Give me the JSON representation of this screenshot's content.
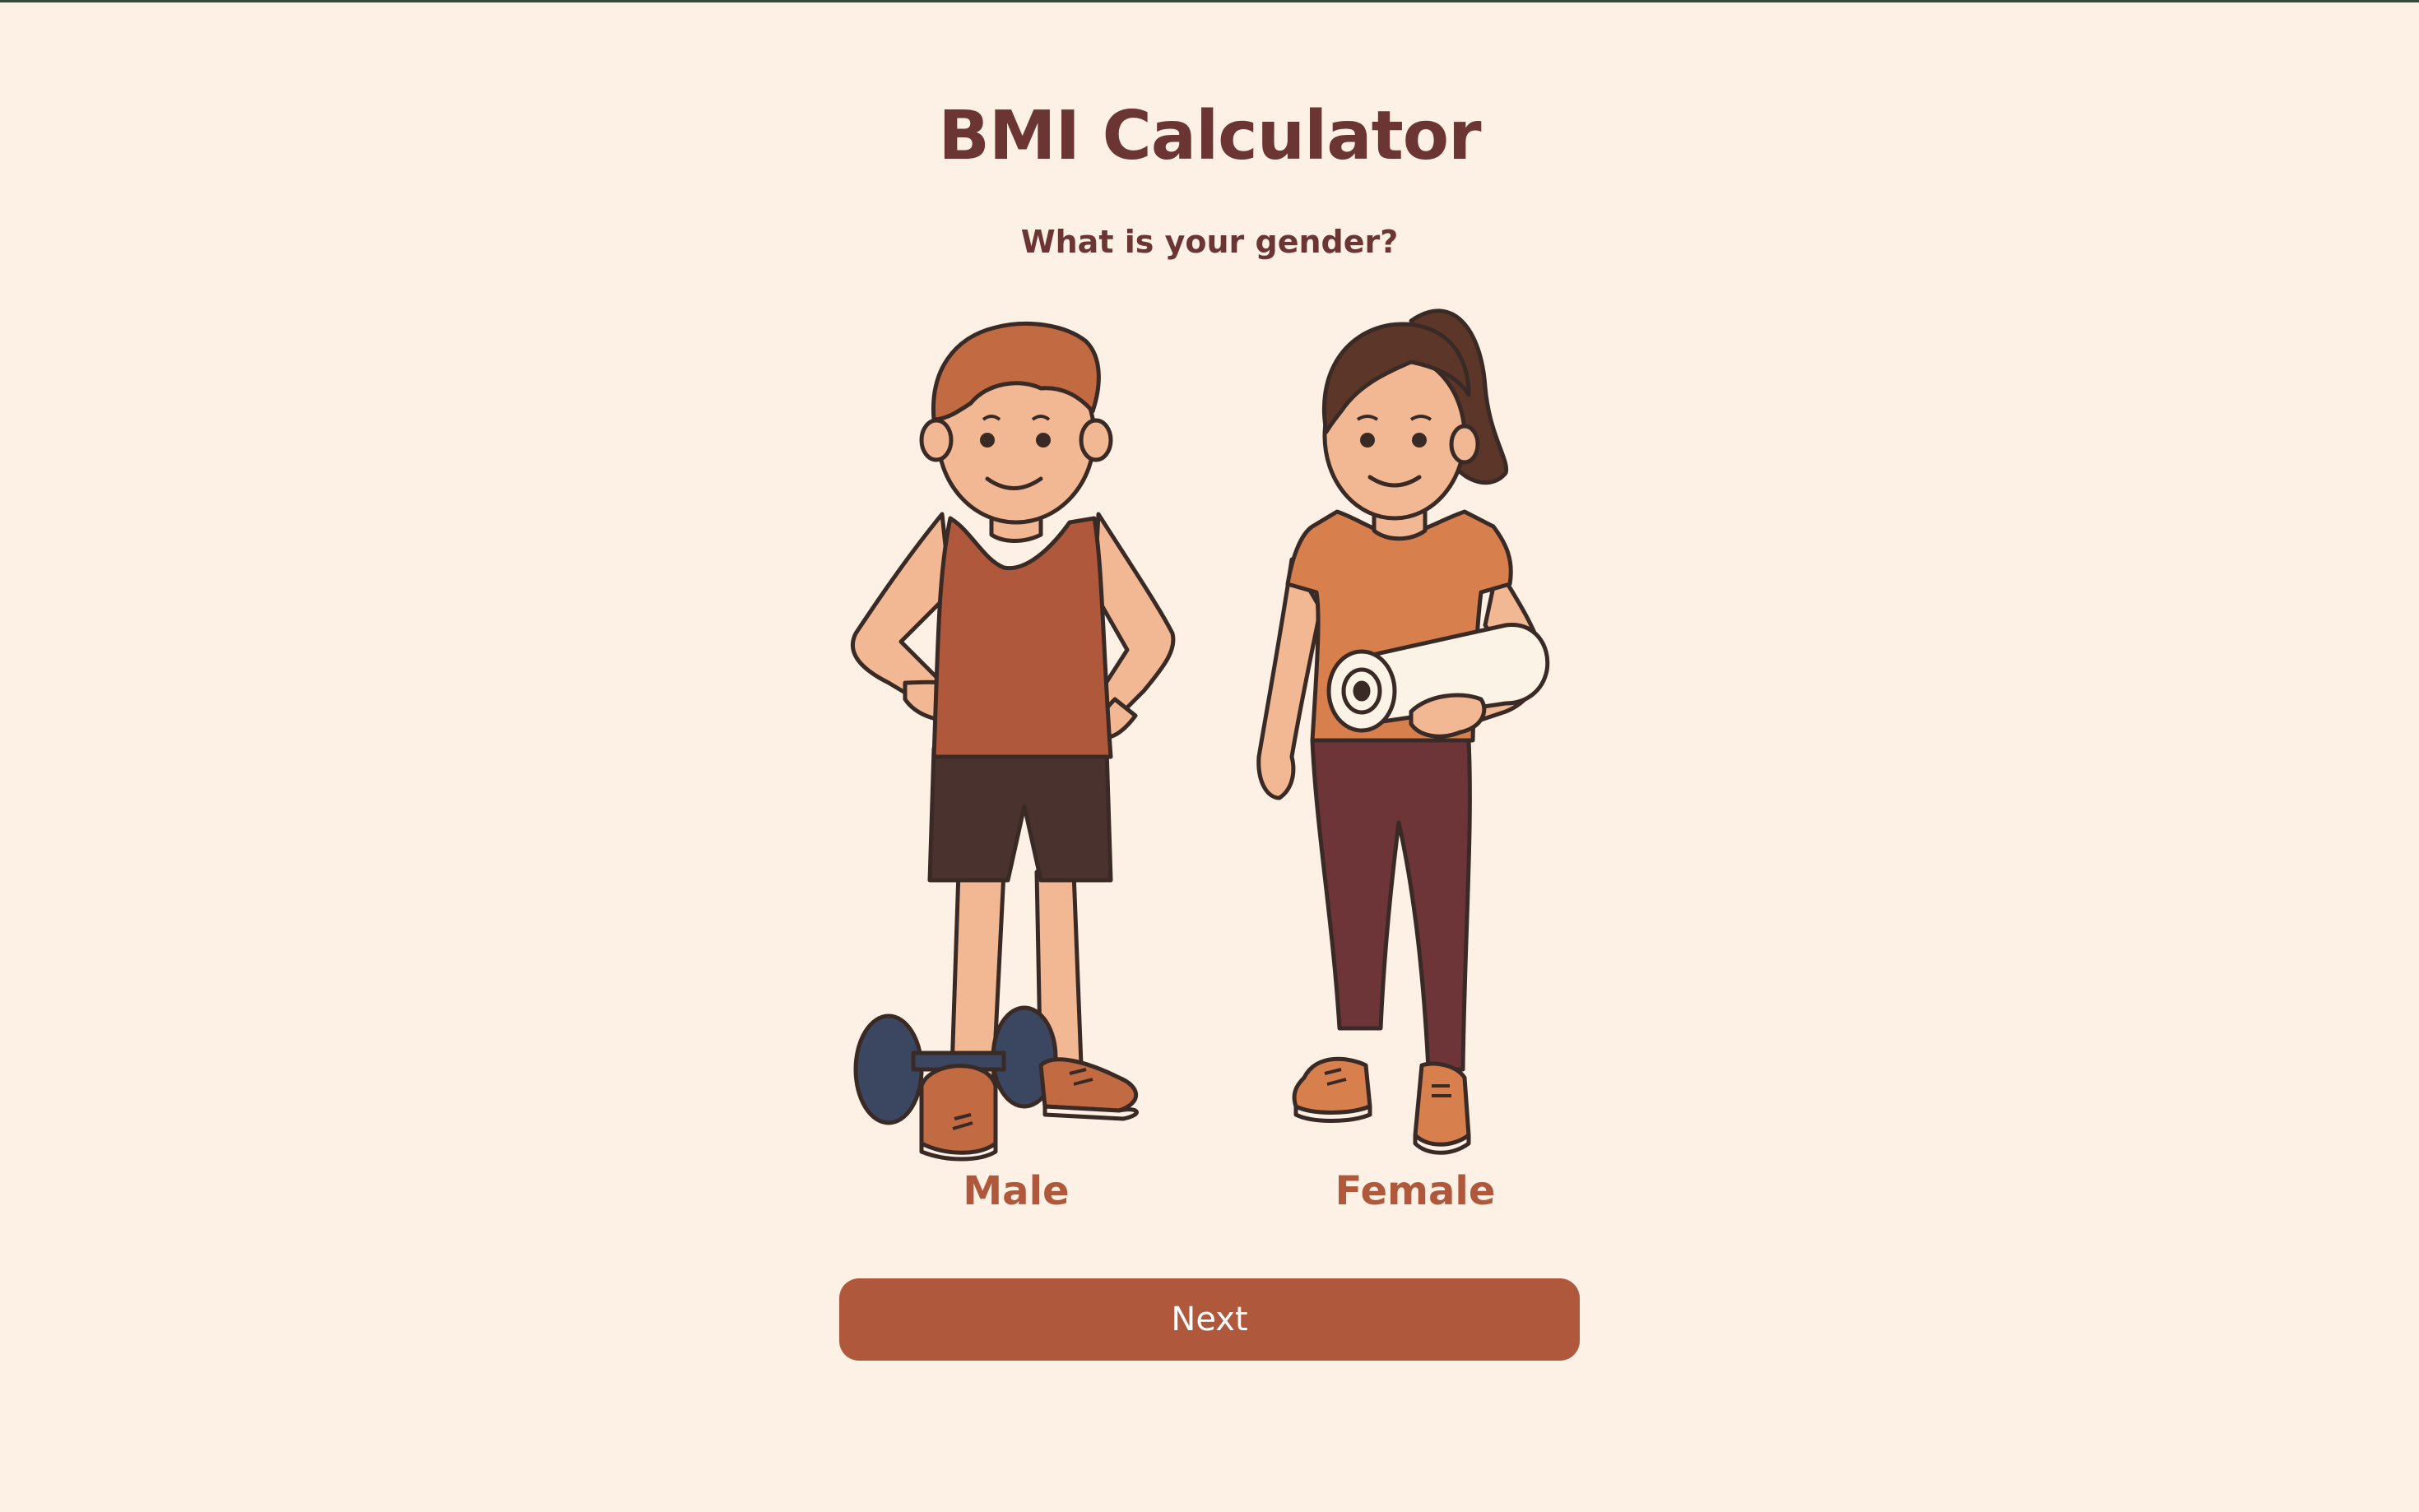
{
  "app": {
    "title": "BMI Calculator",
    "question": "What is your gender?"
  },
  "options": [
    {
      "id": "male",
      "label": "Male",
      "illustration": "man-with-dumbbell-illustration"
    },
    {
      "id": "female",
      "label": "Female",
      "illustration": "woman-with-yoga-mat-illustration"
    }
  ],
  "actions": {
    "next_label": "Next"
  },
  "colors": {
    "background": "#fdf1e6",
    "title": "#6b3534",
    "accent": "#b0583b",
    "button_text": "#ffffff"
  }
}
